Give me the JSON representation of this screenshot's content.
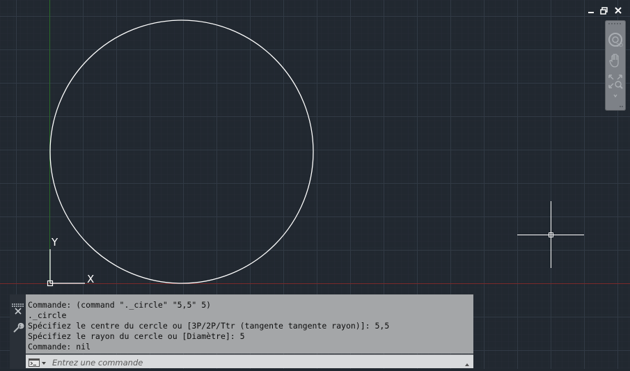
{
  "window": {
    "minimize_icon": "minimize-icon",
    "restore_icon": "restore-icon",
    "close_icon": "close-icon"
  },
  "navigation_bar": {
    "buttons": [
      "steering-wheel-icon",
      "pan-icon",
      "zoom-extents-icon",
      "chevron-down-icon"
    ]
  },
  "drawing": {
    "ucs_labels": {
      "x": "X",
      "y": "Y"
    },
    "colors": {
      "background": "#212830",
      "x_axis": "#8b2323",
      "y_axis": "#1f6b1f",
      "entity": "#ffffff"
    }
  },
  "command_line": {
    "side_icons": [
      "grip-icon",
      "close-icon",
      "customize-wrench-icon"
    ],
    "history": [
      "Commande: (command \"._circle\" \"5,5\" 5)",
      "._circle",
      "Spécifiez le centre du cercle ou [3P/2P/Ttr (tangente tangente rayon)]: 5,5",
      "Spécifiez le rayon du cercle ou [Diamètre]: 5",
      "Commande: nil"
    ],
    "input_placeholder": "Entrez une commande",
    "input_value": "",
    "prompt_icon": "command-prompt-icon",
    "recent_commands_icon": "caret-up-icon"
  }
}
